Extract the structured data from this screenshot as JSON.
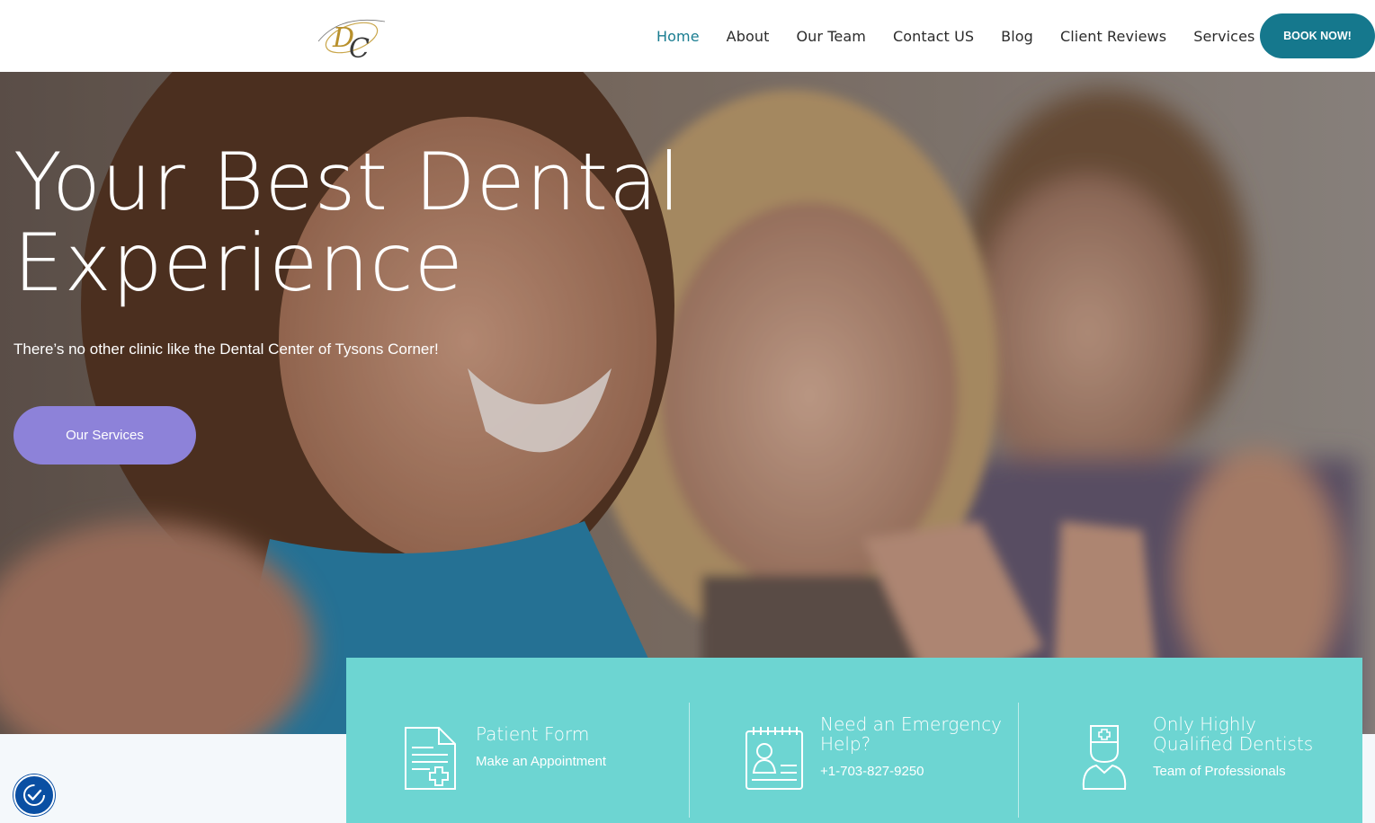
{
  "header": {
    "nav": [
      "Home",
      "About",
      "Our Team",
      "Contact US",
      "Blog",
      "Client Reviews",
      "Services"
    ],
    "active_index": 0,
    "book_label": "BOOK NOW!"
  },
  "hero": {
    "title_line1": "Your Best Dental",
    "title_line2": "Experience",
    "subtitle": "There’s no other clinic like the Dental Center of Tysons Corner!",
    "cta_label": "Our Services"
  },
  "info": {
    "patient": {
      "title": "Patient Form",
      "text": "Make an Appointment",
      "icon": "patient-form-icon"
    },
    "emergency": {
      "title_line1": "Need an Emergency",
      "title_line2": "Help?",
      "text": "+1-703-827-9250",
      "icon": "id-card-icon"
    },
    "dentists": {
      "title_line1": "Only Highly",
      "title_line2": "Qualified Dentists",
      "text": "Team of Professionals",
      "icon": "nurse-icon"
    }
  },
  "colors": {
    "brand": "#15788d",
    "cta": "#8d82d9",
    "band": "#6dd5d2",
    "active_nav": "#1a7d91"
  },
  "accessibility": {
    "icon": "accessibility-check-icon"
  }
}
